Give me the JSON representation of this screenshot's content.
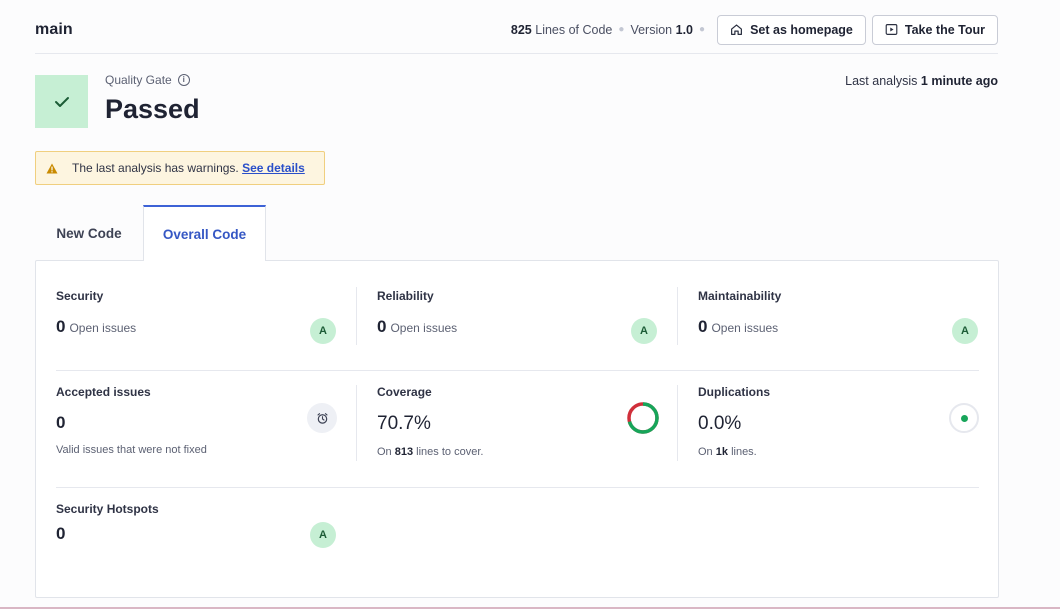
{
  "header": {
    "branch": "main",
    "lines_of_code_value": "825",
    "lines_of_code_label": "Lines of Code",
    "version_label": "Version",
    "version_value": "1.0",
    "set_homepage_label": "Set as homepage",
    "take_tour_label": "Take the Tour"
  },
  "quality_gate": {
    "label": "Quality Gate",
    "status": "Passed",
    "status_color": "#c6efd4",
    "last_analysis_label": "Last analysis",
    "last_analysis_value": "1 minute ago"
  },
  "warning": {
    "text": "The last analysis has warnings.",
    "link": "See details"
  },
  "tabs": [
    {
      "label": "New Code",
      "active": false
    },
    {
      "label": "Overall Code",
      "active": true
    }
  ],
  "metrics": {
    "security": {
      "title": "Security",
      "value": "0",
      "sub": "Open issues",
      "rating": "A"
    },
    "reliability": {
      "title": "Reliability",
      "value": "0",
      "sub": "Open issues",
      "rating": "A"
    },
    "maintainability": {
      "title": "Maintainability",
      "value": "0",
      "sub": "Open issues",
      "rating": "A"
    },
    "accepted_issues": {
      "title": "Accepted issues",
      "value": "0",
      "note": "Valid issues that were not fixed"
    },
    "coverage": {
      "title": "Coverage",
      "value": "70.7%",
      "coverage_fraction": 0.707,
      "note_prefix": "On",
      "note_value": "813",
      "note_suffix": "lines to cover."
    },
    "duplications": {
      "title": "Duplications",
      "value": "0.0%",
      "note_prefix": "On",
      "note_value": "1k",
      "note_suffix": "lines."
    },
    "security_hotspots": {
      "title": "Security Hotspots",
      "value": "0",
      "rating": "A"
    }
  },
  "colors": {
    "accent": "#3d62d6",
    "rating_bg": "#c6efd4",
    "coverage_good": "#17a55a",
    "coverage_bad": "#d02f3a",
    "warning_bg": "#fdf5e0"
  }
}
